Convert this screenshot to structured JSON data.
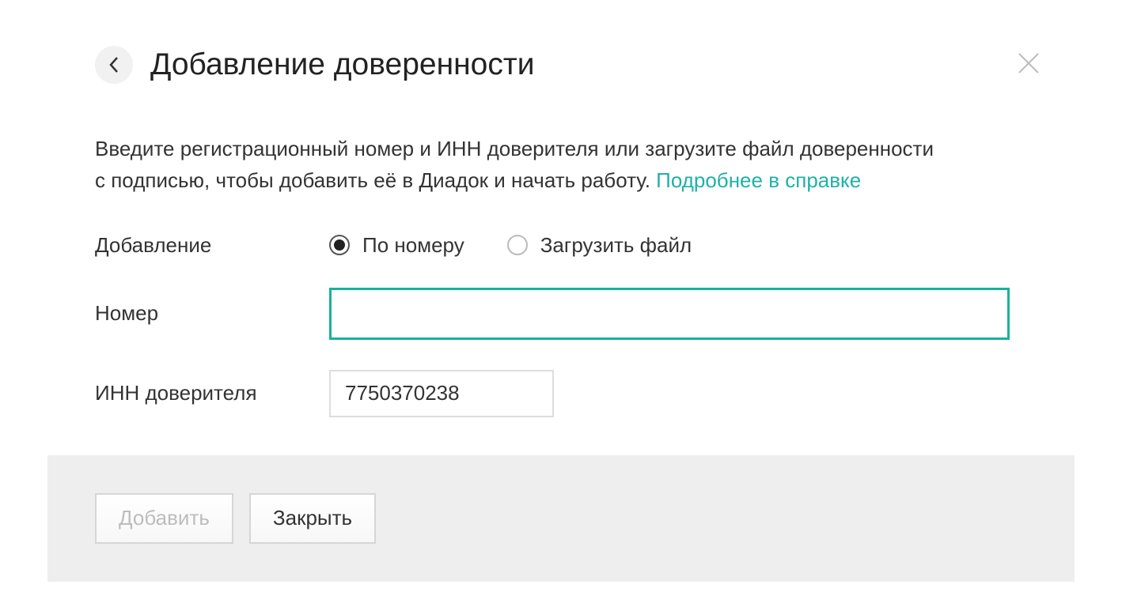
{
  "header": {
    "title": "Добавление доверенности"
  },
  "body": {
    "description_part1": "Введите регистрационный номер и ИНН доверителя или загрузите файл доверенности с подписью, чтобы добавить её в Диадок и начать работу. ",
    "help_link": "Подробнее в справке",
    "add_method_label": "Добавление",
    "radio_by_number": "По номеру",
    "radio_upload": "Загрузить файл",
    "number_label": "Номер",
    "number_value": "",
    "inn_label": "ИНН доверителя",
    "inn_value": "7750370238"
  },
  "footer": {
    "add_label": "Добавить",
    "close_label": "Закрыть"
  }
}
